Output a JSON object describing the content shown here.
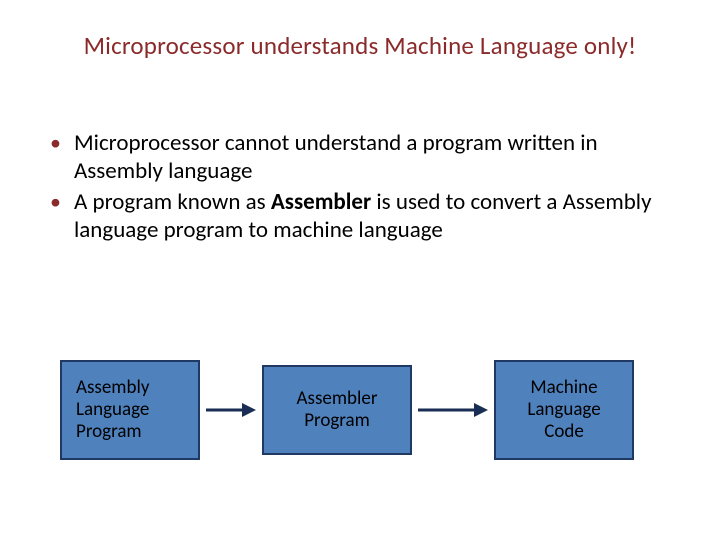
{
  "title": "Microprocessor understands Machine Language only!",
  "bullets": {
    "item1_part1": "Microprocessor cannot understand a program written in Assembly language",
    "item2_pre": "A program known as ",
    "item2_bold": "Assembler",
    "item2_post": " is used to convert a Assembly language program to machine language"
  },
  "diagram": {
    "box1": "Assembly Language Program",
    "box2": "Assembler Program",
    "box3": "Machine Language Code"
  },
  "colors": {
    "title": "#8b2a2a",
    "box_fill": "#4f81bd",
    "box_border": "#1f3864",
    "arrow": "#1a2e55"
  }
}
